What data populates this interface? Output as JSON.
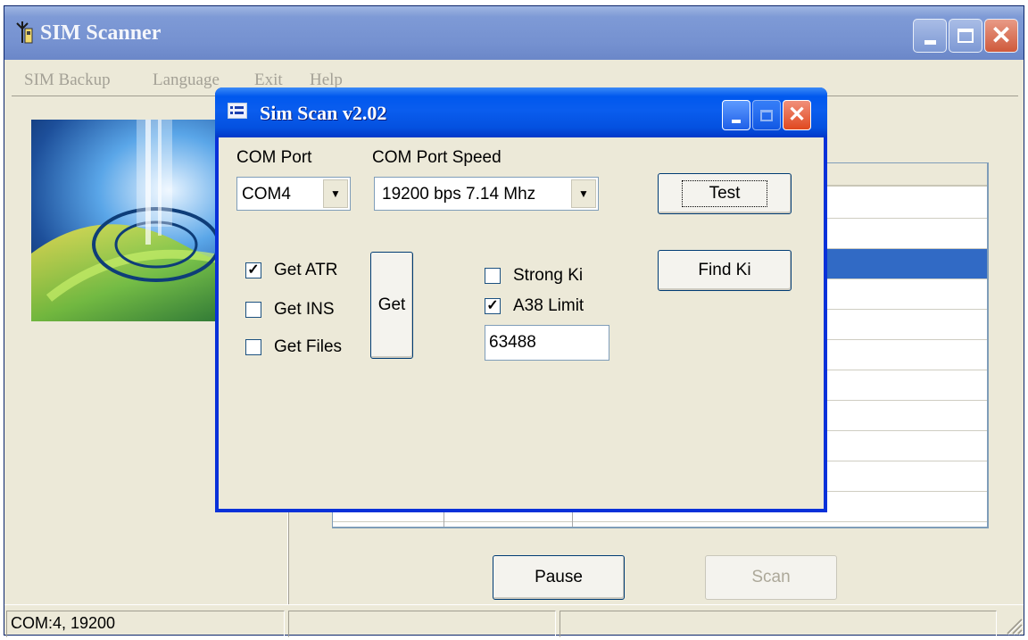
{
  "main_window": {
    "title": "SIM Scanner",
    "menu": [
      "SIM Backup",
      "Language",
      "Exit",
      "Help"
    ],
    "buttons": {
      "pause": "Pause",
      "scan": "Scan"
    },
    "status": {
      "connection": "COM:4, 19200",
      "pane2": "",
      "pane3": ""
    }
  },
  "dialog": {
    "title": "Sim Scan v2.02",
    "com_port": {
      "label": "COM Port",
      "value": "COM4"
    },
    "com_speed": {
      "label": "COM Port Speed",
      "value": "19200 bps  7.14 Mhz"
    },
    "checkboxes": {
      "get_atr": {
        "label": "Get ATR",
        "checked": true
      },
      "get_ins": {
        "label": "Get INS",
        "checked": false
      },
      "get_files": {
        "label": "Get Files",
        "checked": false
      },
      "strong_ki": {
        "label": "Strong Ki",
        "checked": false
      },
      "a38_limit": {
        "label": "A38 Limit",
        "checked": true
      }
    },
    "a38_value": "63488",
    "buttons": {
      "test": "Test",
      "get": "Get",
      "find_ki": "Find Ki"
    }
  },
  "colors": {
    "dialog_title": "#0058ee",
    "selection": "#316ac5",
    "window_bg": "#ece9d8"
  },
  "icons": [
    "app-icon",
    "dialog-app-icon",
    "minimize-icon",
    "maximize-icon",
    "close-icon",
    "dropdown-arrow-icon",
    "checkmark-icon",
    "resize-grip-icon"
  ]
}
